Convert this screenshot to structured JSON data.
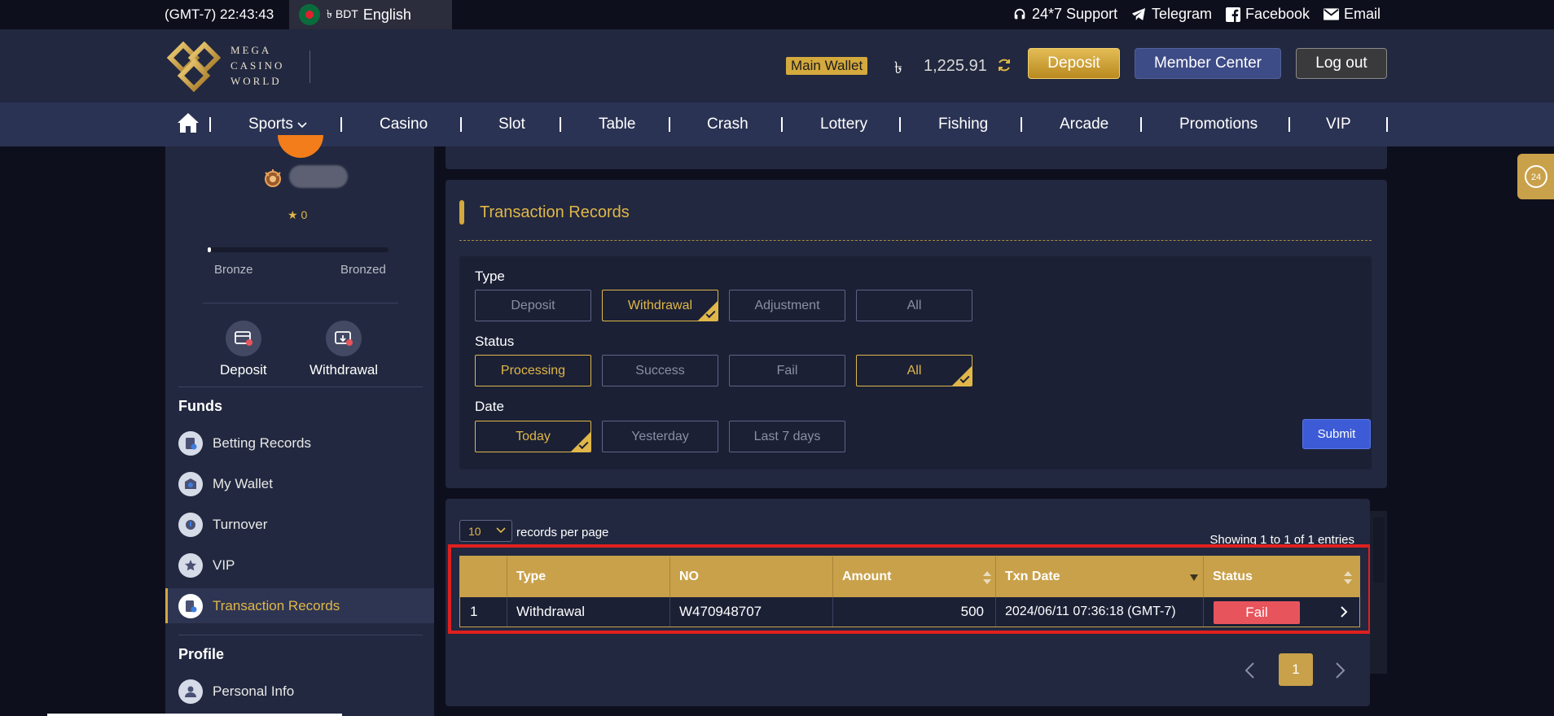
{
  "topbar": {
    "clock": "(GMT-7) 22:43:43",
    "currency": "৳ BDT",
    "language": "English",
    "links": {
      "support": "24*7 Support",
      "telegram": "Telegram",
      "facebook": "Facebook",
      "email": "Email"
    }
  },
  "header": {
    "logo_lines": [
      "MEGA",
      "CASINO",
      "WORLD"
    ],
    "wallet_label": "Main Wallet",
    "currency_symbol": "৳",
    "balance": "1,225.91",
    "deposit_label": "Deposit",
    "member_center_label": "Member Center",
    "logout_label": "Log out",
    "brand_color": "#d4a93d"
  },
  "nav": {
    "items": [
      "Sports",
      "Casino",
      "Slot",
      "Table",
      "Crash",
      "Lottery",
      "Fishing",
      "Arcade",
      "Promotions",
      "VIP"
    ]
  },
  "sidebar": {
    "vip_level": "0",
    "level_from": "Bronze",
    "level_to": "Bronzed",
    "level_progress_fraction": 0.02,
    "quick_actions": [
      "Deposit",
      "Withdrawal"
    ],
    "funds_heading": "Funds",
    "funds_items": [
      "Betting Records",
      "My Wallet",
      "Turnover",
      "VIP",
      "Transaction Records"
    ],
    "active_item": "Transaction Records",
    "profile_heading": "Profile",
    "profile_items": [
      "Personal Info"
    ]
  },
  "filters": {
    "title": "Transaction Records",
    "type_label": "Type",
    "type_options": [
      "Deposit",
      "Withdrawal",
      "Adjustment",
      "All"
    ],
    "type_selected": "Withdrawal",
    "status_label": "Status",
    "status_options": [
      "Processing",
      "Success",
      "Fail",
      "All"
    ],
    "status_selected": [
      "Processing",
      "All"
    ],
    "date_label": "Date",
    "date_options": [
      "Today",
      "Yesterday",
      "Last 7 days"
    ],
    "date_selected": "Today",
    "submit_label": "Submit"
  },
  "records": {
    "per_page": "10",
    "per_page_label": "records per page",
    "showing": "Showing 1 to 1 of 1 entries",
    "columns": [
      "",
      "Type",
      "NO",
      "Amount",
      "Txn Date",
      "Status"
    ],
    "rows": [
      {
        "index": "1",
        "type": "Withdrawal",
        "no": "W470948707",
        "amount": "500",
        "txn_date": "2024/06/11 07:36:18 (GMT-7)",
        "status": "Fail"
      }
    ],
    "current_page": "1",
    "status_fail_color": "#e8545c"
  }
}
